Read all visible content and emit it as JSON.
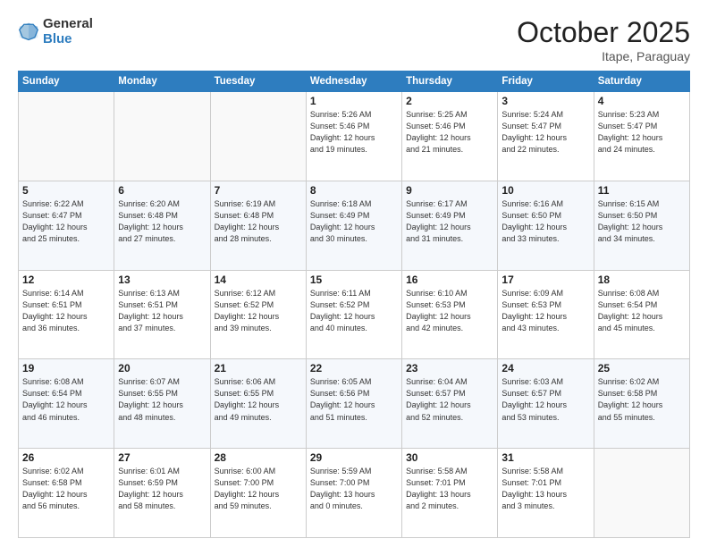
{
  "header": {
    "logo_line1": "General",
    "logo_line2": "Blue",
    "month": "October 2025",
    "location": "Itape, Paraguay"
  },
  "weekdays": [
    "Sunday",
    "Monday",
    "Tuesday",
    "Wednesday",
    "Thursday",
    "Friday",
    "Saturday"
  ],
  "weeks": [
    [
      {
        "day": "",
        "detail": ""
      },
      {
        "day": "",
        "detail": ""
      },
      {
        "day": "",
        "detail": ""
      },
      {
        "day": "1",
        "detail": "Sunrise: 5:26 AM\nSunset: 5:46 PM\nDaylight: 12 hours\nand 19 minutes."
      },
      {
        "day": "2",
        "detail": "Sunrise: 5:25 AM\nSunset: 5:46 PM\nDaylight: 12 hours\nand 21 minutes."
      },
      {
        "day": "3",
        "detail": "Sunrise: 5:24 AM\nSunset: 5:47 PM\nDaylight: 12 hours\nand 22 minutes."
      },
      {
        "day": "4",
        "detail": "Sunrise: 5:23 AM\nSunset: 5:47 PM\nDaylight: 12 hours\nand 24 minutes."
      }
    ],
    [
      {
        "day": "5",
        "detail": "Sunrise: 6:22 AM\nSunset: 6:47 PM\nDaylight: 12 hours\nand 25 minutes."
      },
      {
        "day": "6",
        "detail": "Sunrise: 6:20 AM\nSunset: 6:48 PM\nDaylight: 12 hours\nand 27 minutes."
      },
      {
        "day": "7",
        "detail": "Sunrise: 6:19 AM\nSunset: 6:48 PM\nDaylight: 12 hours\nand 28 minutes."
      },
      {
        "day": "8",
        "detail": "Sunrise: 6:18 AM\nSunset: 6:49 PM\nDaylight: 12 hours\nand 30 minutes."
      },
      {
        "day": "9",
        "detail": "Sunrise: 6:17 AM\nSunset: 6:49 PM\nDaylight: 12 hours\nand 31 minutes."
      },
      {
        "day": "10",
        "detail": "Sunrise: 6:16 AM\nSunset: 6:50 PM\nDaylight: 12 hours\nand 33 minutes."
      },
      {
        "day": "11",
        "detail": "Sunrise: 6:15 AM\nSunset: 6:50 PM\nDaylight: 12 hours\nand 34 minutes."
      }
    ],
    [
      {
        "day": "12",
        "detail": "Sunrise: 6:14 AM\nSunset: 6:51 PM\nDaylight: 12 hours\nand 36 minutes."
      },
      {
        "day": "13",
        "detail": "Sunrise: 6:13 AM\nSunset: 6:51 PM\nDaylight: 12 hours\nand 37 minutes."
      },
      {
        "day": "14",
        "detail": "Sunrise: 6:12 AM\nSunset: 6:52 PM\nDaylight: 12 hours\nand 39 minutes."
      },
      {
        "day": "15",
        "detail": "Sunrise: 6:11 AM\nSunset: 6:52 PM\nDaylight: 12 hours\nand 40 minutes."
      },
      {
        "day": "16",
        "detail": "Sunrise: 6:10 AM\nSunset: 6:53 PM\nDaylight: 12 hours\nand 42 minutes."
      },
      {
        "day": "17",
        "detail": "Sunrise: 6:09 AM\nSunset: 6:53 PM\nDaylight: 12 hours\nand 43 minutes."
      },
      {
        "day": "18",
        "detail": "Sunrise: 6:08 AM\nSunset: 6:54 PM\nDaylight: 12 hours\nand 45 minutes."
      }
    ],
    [
      {
        "day": "19",
        "detail": "Sunrise: 6:08 AM\nSunset: 6:54 PM\nDaylight: 12 hours\nand 46 minutes."
      },
      {
        "day": "20",
        "detail": "Sunrise: 6:07 AM\nSunset: 6:55 PM\nDaylight: 12 hours\nand 48 minutes."
      },
      {
        "day": "21",
        "detail": "Sunrise: 6:06 AM\nSunset: 6:55 PM\nDaylight: 12 hours\nand 49 minutes."
      },
      {
        "day": "22",
        "detail": "Sunrise: 6:05 AM\nSunset: 6:56 PM\nDaylight: 12 hours\nand 51 minutes."
      },
      {
        "day": "23",
        "detail": "Sunrise: 6:04 AM\nSunset: 6:57 PM\nDaylight: 12 hours\nand 52 minutes."
      },
      {
        "day": "24",
        "detail": "Sunrise: 6:03 AM\nSunset: 6:57 PM\nDaylight: 12 hours\nand 53 minutes."
      },
      {
        "day": "25",
        "detail": "Sunrise: 6:02 AM\nSunset: 6:58 PM\nDaylight: 12 hours\nand 55 minutes."
      }
    ],
    [
      {
        "day": "26",
        "detail": "Sunrise: 6:02 AM\nSunset: 6:58 PM\nDaylight: 12 hours\nand 56 minutes."
      },
      {
        "day": "27",
        "detail": "Sunrise: 6:01 AM\nSunset: 6:59 PM\nDaylight: 12 hours\nand 58 minutes."
      },
      {
        "day": "28",
        "detail": "Sunrise: 6:00 AM\nSunset: 7:00 PM\nDaylight: 12 hours\nand 59 minutes."
      },
      {
        "day": "29",
        "detail": "Sunrise: 5:59 AM\nSunset: 7:00 PM\nDaylight: 13 hours\nand 0 minutes."
      },
      {
        "day": "30",
        "detail": "Sunrise: 5:58 AM\nSunset: 7:01 PM\nDaylight: 13 hours\nand 2 minutes."
      },
      {
        "day": "31",
        "detail": "Sunrise: 5:58 AM\nSunset: 7:01 PM\nDaylight: 13 hours\nand 3 minutes."
      },
      {
        "day": "",
        "detail": ""
      }
    ]
  ]
}
